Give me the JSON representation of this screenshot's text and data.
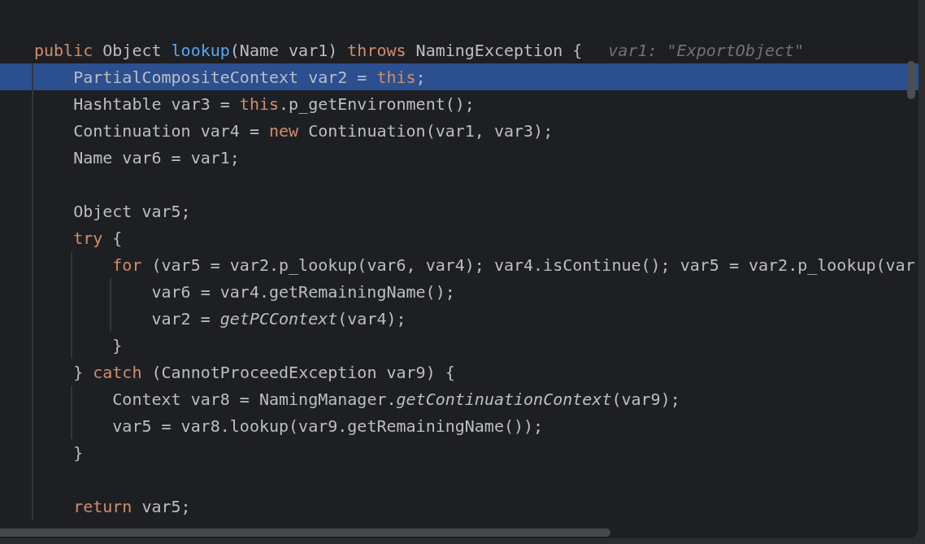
{
  "editor": {
    "lines": [
      {
        "selected": false
      },
      {
        "selected": false
      },
      {
        "selected": false,
        "tokens": [
          {
            "kind": "keyword",
            "text": "public"
          },
          {
            "kind": "plain",
            "text": " Object "
          },
          {
            "kind": "method",
            "text": "lookup"
          },
          {
            "kind": "plain",
            "text": "(Name var1) "
          },
          {
            "kind": "keyword",
            "text": "throws"
          },
          {
            "kind": "plain",
            "text": " NamingException {"
          }
        ],
        "hint": "var1: \"ExportObject\""
      },
      {
        "selected": true,
        "tokens": [
          {
            "kind": "plain",
            "text": "    PartialCompositeContext var2 = "
          },
          {
            "kind": "keyword",
            "text": "this"
          },
          {
            "kind": "plain",
            "text": ";"
          }
        ]
      },
      {
        "selected": false,
        "tokens": [
          {
            "kind": "plain",
            "text": "    Hashtable var3 = "
          },
          {
            "kind": "keyword",
            "text": "this"
          },
          {
            "kind": "plain",
            "text": ".p_getEnvironment();"
          }
        ]
      },
      {
        "selected": false,
        "tokens": [
          {
            "kind": "plain",
            "text": "    Continuation var4 = "
          },
          {
            "kind": "keyword",
            "text": "new"
          },
          {
            "kind": "plain",
            "text": " Continuation(var1, var3);"
          }
        ]
      },
      {
        "selected": false,
        "tokens": [
          {
            "kind": "plain",
            "text": "    Name var6 = var1;"
          }
        ]
      },
      {
        "selected": false
      },
      {
        "selected": false,
        "tokens": [
          {
            "kind": "plain",
            "text": "    Object var5;"
          }
        ]
      },
      {
        "selected": false,
        "tokens": [
          {
            "kind": "keyword",
            "text": "    try"
          },
          {
            "kind": "plain",
            "text": " {"
          }
        ]
      },
      {
        "selected": false,
        "tokens": [
          {
            "kind": "keyword",
            "text": "        for"
          },
          {
            "kind": "plain",
            "text": " (var5 = var2.p_lookup(var6, var4); var4.isContinue(); var5 = var2.p_lookup(var"
          }
        ]
      },
      {
        "selected": false,
        "tokens": [
          {
            "kind": "plain",
            "text": "            var6 = var4.getRemainingName();"
          }
        ]
      },
      {
        "selected": false,
        "tokens": [
          {
            "kind": "plain",
            "text": "            var2 = "
          },
          {
            "kind": "static",
            "text": "getPCContext"
          },
          {
            "kind": "plain",
            "text": "(var4);"
          }
        ]
      },
      {
        "selected": false,
        "tokens": [
          {
            "kind": "plain",
            "text": "        }"
          }
        ]
      },
      {
        "selected": false,
        "tokens": [
          {
            "kind": "plain",
            "text": "    } "
          },
          {
            "kind": "keyword",
            "text": "catch"
          },
          {
            "kind": "plain",
            "text": " (CannotProceedException var9) {"
          }
        ]
      },
      {
        "selected": false,
        "tokens": [
          {
            "kind": "plain",
            "text": "        Context var8 = NamingManager."
          },
          {
            "kind": "static",
            "text": "getContinuationContext"
          },
          {
            "kind": "plain",
            "text": "(var9);"
          }
        ]
      },
      {
        "selected": false,
        "tokens": [
          {
            "kind": "plain",
            "text": "        var5 = var8.lookup(var9.getRemainingName());"
          }
        ]
      },
      {
        "selected": false,
        "tokens": [
          {
            "kind": "plain",
            "text": "    }"
          }
        ]
      },
      {
        "selected": false
      },
      {
        "selected": false,
        "tokens": [
          {
            "kind": "keyword",
            "text": "    return"
          },
          {
            "kind": "plain",
            "text": " var5;"
          }
        ]
      },
      {
        "selected": false
      }
    ]
  }
}
